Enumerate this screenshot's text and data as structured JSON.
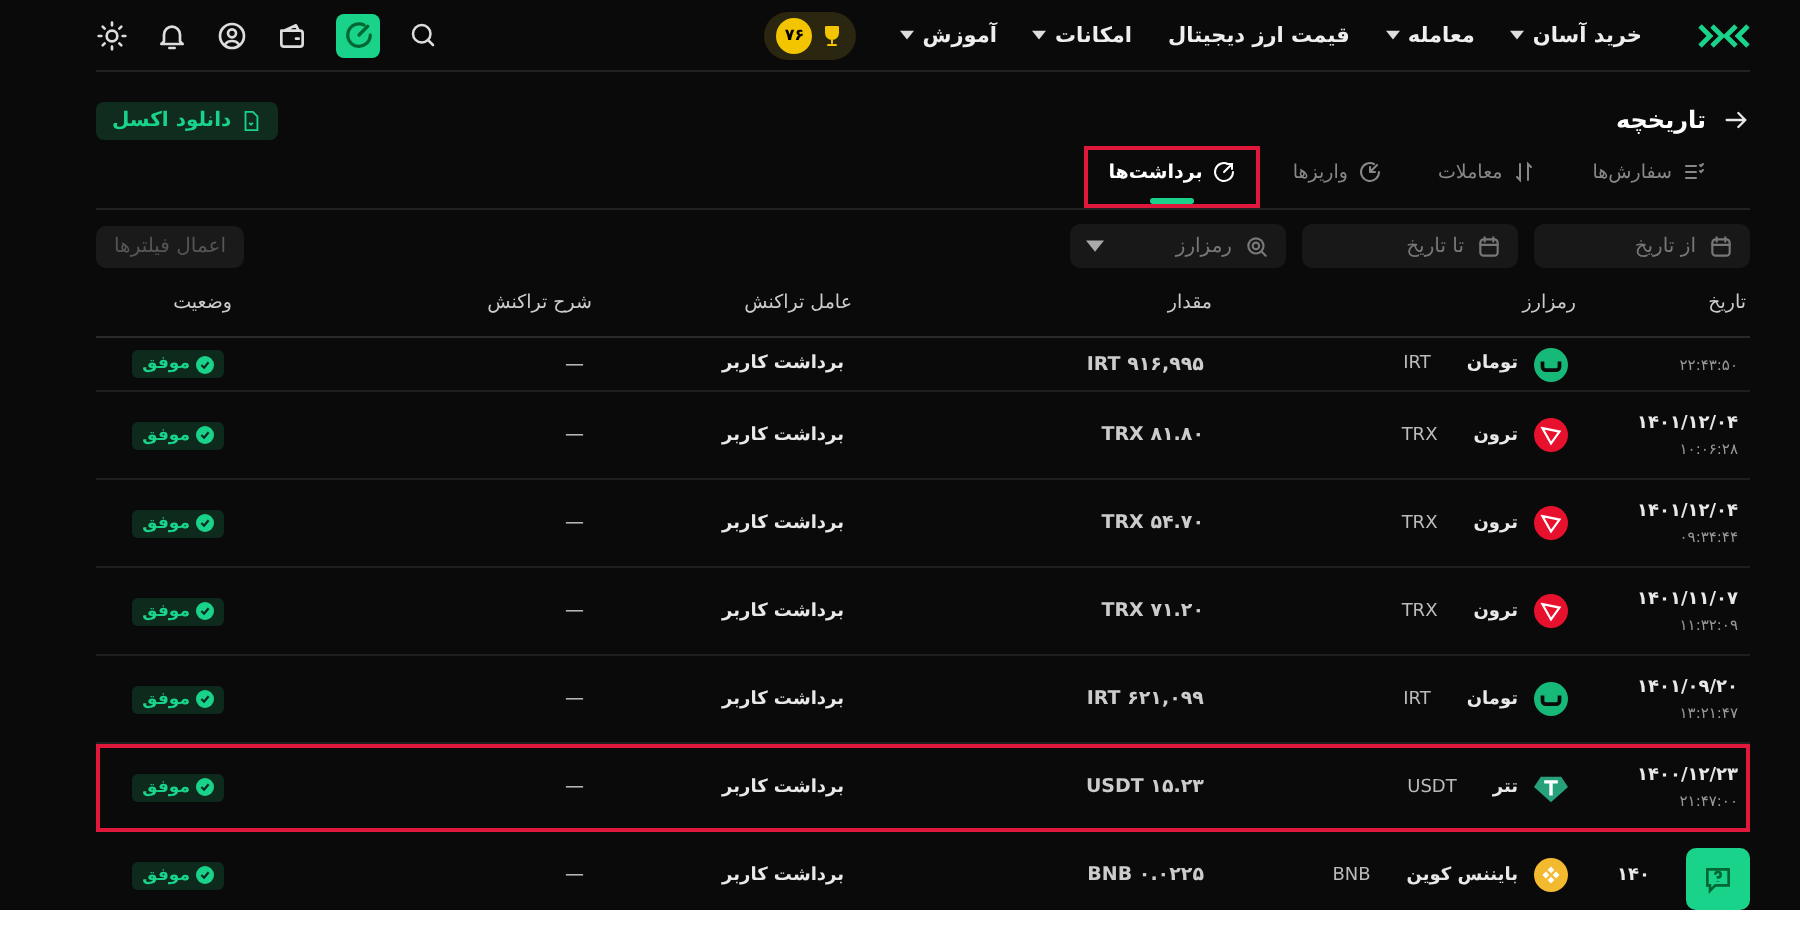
{
  "nav": {
    "items": [
      {
        "label": "خرید آسان",
        "dropdown": true
      },
      {
        "label": "معامله",
        "dropdown": true
      },
      {
        "label": "قیمت ارز دیجیتال",
        "dropdown": false
      },
      {
        "label": "امکانات",
        "dropdown": true
      },
      {
        "label": "آموزش",
        "dropdown": true
      }
    ],
    "level_badge": "۷۶"
  },
  "page": {
    "title": "تاریخچه",
    "download_button": "دانلود اکسل"
  },
  "tabs": [
    {
      "label": "سفارش‌ها",
      "selected": false,
      "highlighted": false
    },
    {
      "label": "معاملات",
      "selected": false,
      "highlighted": false
    },
    {
      "label": "واریزها",
      "selected": false,
      "highlighted": false
    },
    {
      "label": "برداشت‌ها",
      "selected": true,
      "highlighted": true
    }
  ],
  "filters": [
    {
      "kind": "date",
      "placeholder": "از تاریخ"
    },
    {
      "kind": "date",
      "placeholder": "تا تاریخ"
    },
    {
      "kind": "select",
      "placeholder": "رمزارز"
    }
  ],
  "apply_button": {
    "label": "اعمال فیلترها",
    "disabled": true
  },
  "table": {
    "columns": [
      "تاریخ",
      "رمزارز",
      "مقدار",
      "عامل تراکنش",
      "شرح تراکنش",
      "وضعیت"
    ],
    "rows": [
      {
        "date": "",
        "time": "۲۲:۴۳:۵۰",
        "coin": "تومان",
        "symbol": "IRT",
        "kind": "toman",
        "amount": "IRT ۹۱۶,۹۹۵",
        "agent": "برداشت کاربر",
        "description": "—",
        "status": "موفق",
        "highlighted": false
      },
      {
        "date": "۱۴۰۱/۱۲/۰۴",
        "time": "۱۰:۰۶:۲۸",
        "coin": "ترون",
        "symbol": "TRX",
        "kind": "tron",
        "amount": "TRX ۸۱.۸۰",
        "agent": "برداشت کاربر",
        "description": "—",
        "status": "موفق",
        "highlighted": false
      },
      {
        "date": "۱۴۰۱/۱۲/۰۴",
        "time": "۰۹:۳۴:۴۴",
        "coin": "ترون",
        "symbol": "TRX",
        "kind": "tron",
        "amount": "TRX ۵۴.۷۰",
        "agent": "برداشت کاربر",
        "description": "—",
        "status": "موفق",
        "highlighted": false
      },
      {
        "date": "۱۴۰۱/۱۱/۰۷",
        "time": "۱۱:۳۲:۰۹",
        "coin": "ترون",
        "symbol": "TRX",
        "kind": "tron",
        "amount": "TRX ۷۱.۲۰",
        "agent": "برداشت کاربر",
        "description": "—",
        "status": "موفق",
        "highlighted": false
      },
      {
        "date": "۱۴۰۱/۰۹/۲۰",
        "time": "۱۳:۲۱:۴۷",
        "coin": "تومان",
        "symbol": "IRT",
        "kind": "toman",
        "amount": "IRT ۶۲۱,۰۹۹",
        "agent": "برداشت کاربر",
        "description": "—",
        "status": "موفق",
        "highlighted": false
      },
      {
        "date": "۱۴۰۰/۱۲/۲۳",
        "time": "۲۱:۴۷:۰۰",
        "coin": "تتر",
        "symbol": "USDT",
        "kind": "tether",
        "amount": "USDT ۱۵.۲۳",
        "agent": "برداشت کاربر",
        "description": "—",
        "status": "موفق",
        "highlighted": true
      },
      {
        "date": "۱۴۰",
        "time": "",
        "coin": "بایننس کوین",
        "symbol": "BNB",
        "kind": "bnb",
        "amount": "BNB ۰.۰۲۲۵",
        "agent": "برداشت کاربر",
        "description": "—",
        "status": "موفق",
        "highlighted": false
      }
    ]
  }
}
